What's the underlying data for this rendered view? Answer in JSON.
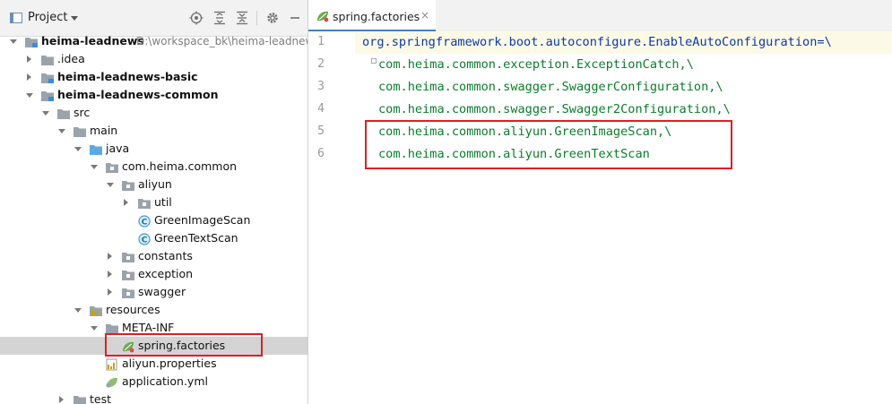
{
  "project_panel": {
    "title": "Project",
    "toolbar_icons": [
      "locate-icon",
      "expand-all-icon",
      "collapse-all-icon",
      "gear-icon",
      "hide-icon"
    ]
  },
  "tree": [
    {
      "label": "heima-leadnews",
      "path": "D:\\workspace_bk\\heima-leadnew",
      "bold": true,
      "state": "expanded",
      "icon": "module-folder-icon"
    },
    {
      "label": ".idea",
      "state": "collapsed",
      "icon": "folder-icon"
    },
    {
      "label": "heima-leadnews-basic",
      "bold": true,
      "state": "collapsed",
      "icon": "module-folder-icon"
    },
    {
      "label": "heima-leadnews-common",
      "bold": true,
      "state": "expanded",
      "icon": "module-folder-icon"
    },
    {
      "label": "src",
      "state": "expanded",
      "icon": "folder-icon"
    },
    {
      "label": "main",
      "state": "expanded",
      "icon": "folder-icon"
    },
    {
      "label": "java",
      "state": "expanded",
      "icon": "source-folder-icon"
    },
    {
      "label": "com.heima.common",
      "state": "expanded",
      "icon": "package-icon"
    },
    {
      "label": "aliyun",
      "state": "expanded",
      "icon": "package-icon"
    },
    {
      "label": "util",
      "state": "collapsed",
      "icon": "package-icon"
    },
    {
      "label": "GreenImageScan",
      "state": "none",
      "icon": "class-icon"
    },
    {
      "label": "GreenTextScan",
      "state": "none",
      "icon": "class-icon"
    },
    {
      "label": "constants",
      "state": "collapsed",
      "icon": "package-icon"
    },
    {
      "label": "exception",
      "state": "collapsed",
      "icon": "package-icon"
    },
    {
      "label": "swagger",
      "state": "collapsed",
      "icon": "package-icon"
    },
    {
      "label": "resources",
      "state": "expanded",
      "icon": "resources-folder-icon"
    },
    {
      "label": "META-INF",
      "state": "expanded",
      "icon": "folder-icon"
    },
    {
      "label": "spring.factories",
      "state": "none",
      "icon": "spring-icon",
      "selected": true
    },
    {
      "label": "aliyun.properties",
      "state": "none",
      "icon": "properties-icon"
    },
    {
      "label": "application.yml",
      "state": "none",
      "icon": "yml-icon"
    },
    {
      "label": "test",
      "state": "collapsed",
      "icon": "folder-icon"
    }
  ],
  "editor": {
    "tab": {
      "label": "spring.factories",
      "close": "×"
    },
    "line_numbers": [
      "1",
      "2",
      "3",
      "4",
      "5",
      "6"
    ],
    "lines": [
      "org.springframework.boot.autoconfigure.EnableAutoConfiguration=\\",
      "com.heima.common.exception.ExceptionCatch,\\",
      "com.heima.common.swagger.SwaggerConfiguration,\\",
      "com.heima.common.swagger.Swagger2Configuration,\\",
      "com.heima.common.aliyun.GreenImageScan,\\",
      "com.heima.common.aliyun.GreenTextScan"
    ]
  },
  "colors": {
    "highlight_box": "#e01e23",
    "key_text": "#0d39a8",
    "value_text": "#0b7d2b",
    "selection": "#d4d4d4"
  }
}
